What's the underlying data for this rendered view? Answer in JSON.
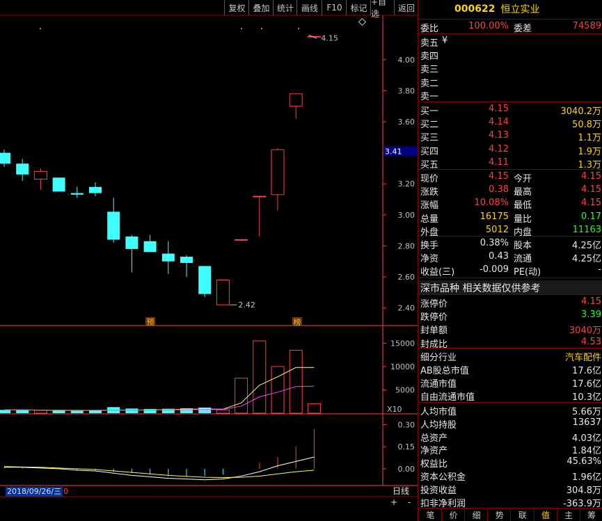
{
  "toolbar": {
    "items": [
      "复权",
      "叠加",
      "统计",
      "画线",
      "F10",
      "标记",
      "+自选",
      "返回"
    ]
  },
  "chart": {
    "price_ticks": [
      "4.00",
      "3.80",
      "3.60",
      "3.40",
      "3.20",
      "3.00",
      "2.80",
      "2.60",
      "2.40"
    ],
    "vol_ticks": [
      "15000",
      "10000",
      "5000"
    ],
    "vol_unit": "X10",
    "macd_ticks": [
      "0.30",
      "0.15",
      "0.00"
    ],
    "current_price_tag": "3.41",
    "high_label": "4.15",
    "low_label": "2.42",
    "marker_yu": "预",
    "marker_bang": "榜",
    "date": "2018/09/26/三",
    "date_suffix": "0",
    "period": "日线",
    "plus": "+",
    "minus": "-"
  },
  "chart_data": {
    "type": "candlestick",
    "up_color": "#ff4040",
    "down_color": "#40ffff",
    "ohlc": [
      {
        "o": 3.4,
        "h": 3.42,
        "l": 3.31,
        "c": 3.33
      },
      {
        "o": 3.33,
        "h": 3.36,
        "l": 3.22,
        "c": 3.26
      },
      {
        "o": 3.23,
        "h": 3.3,
        "l": 3.16,
        "c": 3.28
      },
      {
        "o": 3.24,
        "h": 3.24,
        "l": 3.15,
        "c": 3.15
      },
      {
        "o": 3.14,
        "h": 3.18,
        "l": 3.11,
        "c": 3.13
      },
      {
        "o": 3.18,
        "h": 3.21,
        "l": 3.12,
        "c": 3.14
      },
      {
        "o": 3.02,
        "h": 3.11,
        "l": 2.82,
        "c": 2.84
      },
      {
        "o": 2.86,
        "h": 2.87,
        "l": 2.63,
        "c": 2.78
      },
      {
        "o": 2.83,
        "h": 2.87,
        "l": 2.77,
        "c": 2.76
      },
      {
        "o": 2.75,
        "h": 2.83,
        "l": 2.62,
        "c": 2.7
      },
      {
        "o": 2.73,
        "h": 2.74,
        "l": 2.6,
        "c": 2.69
      },
      {
        "o": 2.67,
        "h": 2.67,
        "l": 2.47,
        "c": 2.49
      },
      {
        "o": 2.42,
        "h": 2.58,
        "l": 2.42,
        "c": 2.58
      },
      {
        "o": 2.84,
        "h": 2.84,
        "l": 2.84,
        "c": 2.84
      },
      {
        "o": 3.12,
        "h": 3.12,
        "l": 2.86,
        "c": 3.12
      },
      {
        "o": 3.13,
        "h": 3.43,
        "l": 3.03,
        "c": 3.42
      },
      {
        "o": 3.7,
        "h": 3.78,
        "l": 3.62,
        "c": 3.78
      },
      {
        "o": 4.15,
        "h": 4.15,
        "l": 4.15,
        "c": 4.15
      }
    ],
    "volume": [
      700,
      650,
      600,
      550,
      500,
      600,
      1300,
      1000,
      900,
      950,
      1050,
      1200,
      700,
      7500,
      15500,
      10000,
      13500,
      2000
    ],
    "vol_ma_a": [
      700,
      700,
      650,
      620,
      600,
      590,
      650,
      680,
      700,
      750,
      850,
      900,
      850,
      2200,
      6000,
      7800,
      9800,
      9800
    ],
    "vol_ma_b": [
      700,
      700,
      680,
      650,
      640,
      630,
      640,
      660,
      680,
      700,
      750,
      800,
      820,
      1500,
      3500,
      4500,
      5700,
      5800
    ],
    "macd_hist": [
      0.01,
      0.01,
      0.0,
      0.0,
      -0.01,
      -0.01,
      -0.02,
      -0.03,
      -0.04,
      -0.05,
      -0.05,
      -0.05,
      -0.04,
      0.0,
      0.04,
      0.08,
      0.15,
      0.27
    ],
    "dif": [
      0.01,
      0.01,
      0.005,
      0.0,
      -0.01,
      -0.015,
      -0.03,
      -0.045,
      -0.055,
      -0.065,
      -0.07,
      -0.075,
      -0.07,
      -0.05,
      -0.02,
      0.02,
      0.05,
      0.08
    ],
    "dea": [
      0.015,
      0.012,
      0.01,
      0.005,
      0.0,
      -0.005,
      -0.015,
      -0.025,
      -0.035,
      -0.045,
      -0.052,
      -0.058,
      -0.06,
      -0.058,
      -0.05,
      -0.035,
      -0.02,
      -0.01
    ],
    "ylim_price": [
      2.3,
      4.25
    ],
    "ylim_vol": [
      0,
      17000
    ],
    "ylim_macd": [
      -0.1,
      0.35
    ]
  },
  "quote": {
    "code": "000622",
    "name": "恒立实业",
    "weibi_label": "委比",
    "weibi": "100.00%",
    "weicha_label": "委差",
    "weicha": "74589",
    "sell": [
      {
        "label": "卖五",
        "price": "",
        "vol": "",
        "note": "¥"
      },
      {
        "label": "卖四",
        "price": "",
        "vol": ""
      },
      {
        "label": "卖三",
        "price": "",
        "vol": ""
      },
      {
        "label": "卖二",
        "price": "",
        "vol": ""
      },
      {
        "label": "卖一",
        "price": "",
        "vol": ""
      }
    ],
    "buy": [
      {
        "label": "买一",
        "price": "4.15",
        "vol": "3040.2万"
      },
      {
        "label": "买二",
        "price": "4.14",
        "vol": "50.8万"
      },
      {
        "label": "买三",
        "price": "4.13",
        "vol": "1.1万"
      },
      {
        "label": "买四",
        "price": "4.12",
        "vol": "1.9万"
      },
      {
        "label": "买五",
        "price": "4.11",
        "vol": "1.3万"
      }
    ],
    "stats1": [
      {
        "l": "现价",
        "v": "4.15",
        "l2": "今开",
        "v2": "4.15"
      },
      {
        "l": "涨跌",
        "v": "0.38",
        "l2": "最高",
        "v2": "4.15"
      },
      {
        "l": "涨幅",
        "v": "10.08%",
        "l2": "最低",
        "v2": "4.15"
      },
      {
        "l": "总量",
        "v": "16175",
        "l2": "量比",
        "v2": "0.17"
      },
      {
        "l": "外盘",
        "v": "5012",
        "l2": "内盘",
        "v2": "11163"
      }
    ],
    "stats2": [
      {
        "l": "换手",
        "v": "0.38%",
        "l2": "股本",
        "v2": "4.25亿"
      },
      {
        "l": "净资",
        "v": "0.43",
        "l2": "流通",
        "v2": "4.25亿"
      },
      {
        "l": "收益(三)",
        "v": "-0.009",
        "l2": "PE(动)",
        "v2": "-"
      }
    ],
    "market_title": "深市品种  相关数据仅供参考",
    "limits": [
      {
        "l": "涨停价",
        "v": "4.15"
      },
      {
        "l": "跌停价",
        "v": "3.39"
      },
      {
        "l": "封单额",
        "v": "3040万"
      },
      {
        "l": "封成比",
        "v": "4.53"
      }
    ],
    "industry_label": "细分行业",
    "industry": "汽车配件",
    "caps": [
      {
        "l": "AB股总市值",
        "v": "17.6亿"
      },
      {
        "l": "流通市值",
        "v": "17.6亿"
      },
      {
        "l": "自由流通市值",
        "v": "10.3亿"
      }
    ],
    "fund": [
      {
        "l": "人均市值",
        "v": "5.66万"
      },
      {
        "l": "人均持股",
        "v": "13637"
      },
      {
        "l": "总资产",
        "v": "4.03亿"
      },
      {
        "l": "净资产",
        "v": "1.84亿"
      },
      {
        "l": "权益比",
        "v": "45.63%"
      },
      {
        "l": "资本公积金",
        "v": "1.96亿"
      },
      {
        "l": "投资收益",
        "v": "304.8万"
      },
      {
        "l": "扣非净利润",
        "v": "-363.9万"
      }
    ],
    "tabs": [
      "笔",
      "价",
      "细",
      "势",
      "联",
      "值",
      "主",
      "筹"
    ],
    "active_tab": "值"
  }
}
